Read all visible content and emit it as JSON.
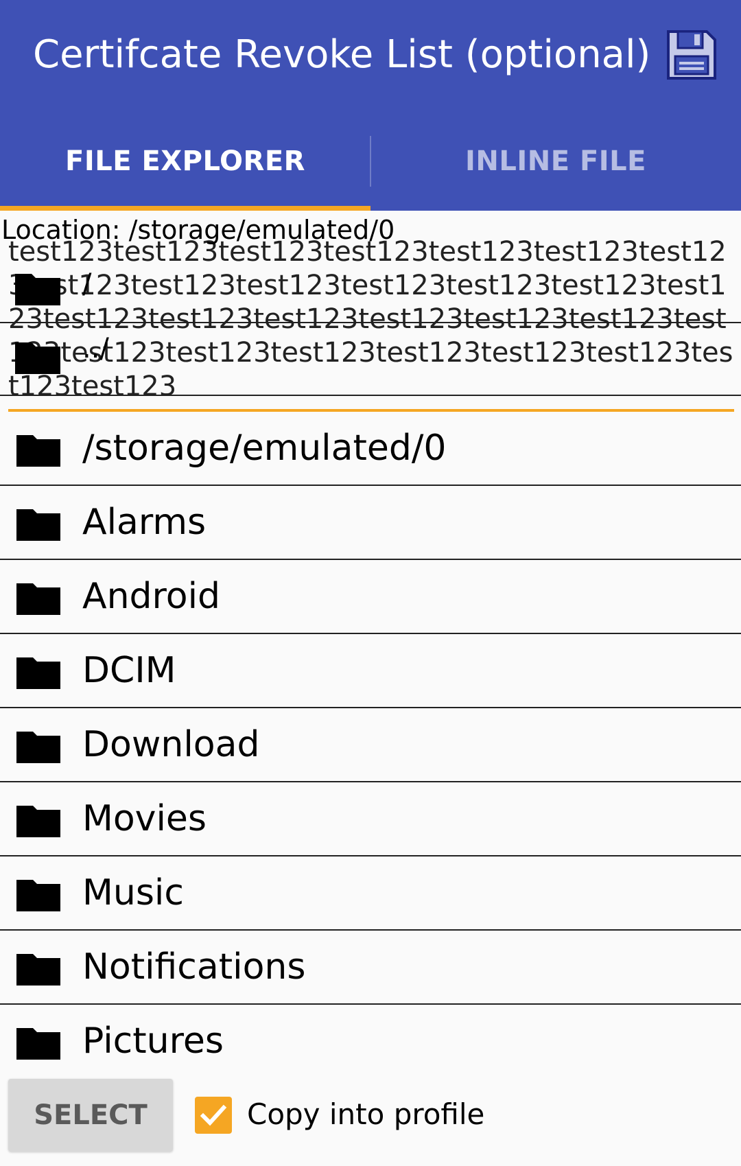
{
  "header": {
    "title": "Certifcate Revoke List (optional)",
    "save_icon": "floppy-disk-icon"
  },
  "tabs": [
    {
      "label": "FILE EXPLORER",
      "active": true
    },
    {
      "label": "INLINE FILE",
      "active": false
    }
  ],
  "explorer": {
    "location": "Location: /storage/emulated/0",
    "inline_text": "test123test123test123test123test123test123test123test123test123test123test123test123test123test123test123test123test123test123test123test123test123test123test123test123test123test123test123test123test123",
    "root_label": "/",
    "parent_label": "../",
    "items": [
      "/storage/emulated/0",
      "Alarms",
      "Android",
      "DCIM",
      "Download",
      "Movies",
      "Music",
      "Notifications",
      "Pictures"
    ]
  },
  "footer": {
    "select_label": "SELECT",
    "copy_label": "Copy into profile",
    "copy_checked": true
  },
  "colors": {
    "primary": "#3f51b5",
    "accent": "#f5a623"
  }
}
